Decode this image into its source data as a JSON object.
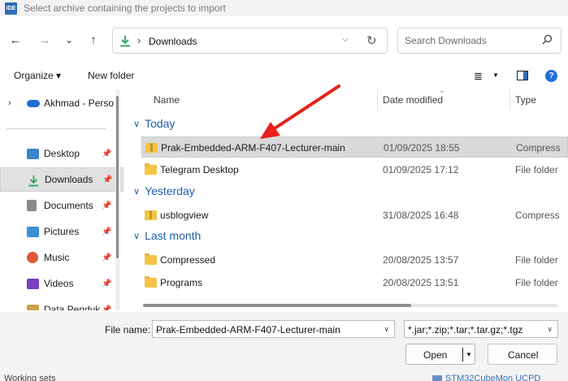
{
  "window": {
    "app_icon_text": "IDE",
    "title": "Select archive containing the projects to import"
  },
  "nav": {
    "back_icon": "←",
    "forward_icon": "→",
    "recent_icon": "⌄",
    "up_icon": "↑",
    "address_path": "Downloads",
    "search_placeholder": "Search Downloads"
  },
  "toolbar": {
    "organize_label": "Organize ▾",
    "new_folder_label": "New folder",
    "view_icon": "≣",
    "help_icon": "?"
  },
  "sidebar": {
    "onedrive_label": "Akhmad - Perso",
    "items": [
      {
        "label": "Desktop",
        "color": "#3a86c8"
      },
      {
        "label": "Downloads",
        "color": "#2aa35a"
      },
      {
        "label": "Documents",
        "color": "#8a8a8a"
      },
      {
        "label": "Pictures",
        "color": "#3a8fd6"
      },
      {
        "label": "Music",
        "color": "#e05a3c"
      },
      {
        "label": "Videos",
        "color": "#7a3fc0"
      },
      {
        "label": "Data Penduk",
        "color": "#c9a24a"
      }
    ]
  },
  "columns": {
    "name": "Name",
    "date_modified": "Date modified",
    "type": "Type"
  },
  "groups": [
    {
      "title": "Today",
      "rows": [
        {
          "name": "Prak-Embedded-ARM-F407-Lecturer-main",
          "date": "01/09/2025 18:55",
          "type": "Compress",
          "icon": "zip"
        },
        {
          "name": "Telegram Desktop",
          "date": "01/09/2025 17:12",
          "type": "File folder",
          "icon": "folder"
        }
      ]
    },
    {
      "title": "Yesterday",
      "rows": [
        {
          "name": "usblogview",
          "date": "31/08/2025 16:48",
          "type": "Compress",
          "icon": "zip"
        }
      ]
    },
    {
      "title": "Last month",
      "rows": [
        {
          "name": "Compressed",
          "date": "20/08/2025 13:57",
          "type": "File folder",
          "icon": "folder"
        },
        {
          "name": "Programs",
          "date": "20/08/2025 13:51",
          "type": "File folder",
          "icon": "folder"
        }
      ]
    }
  ],
  "footer": {
    "file_name_label": "File name:",
    "file_name_value": "Prak-Embedded-ARM-F407-Lecturer-main",
    "file_type_value": "*.jar;*.zip;*.tar;*.tar.gz;*.tgz",
    "open_label": "Open",
    "cancel_label": "Cancel"
  },
  "behind": {
    "left_text": "Working sets",
    "right_text": "STM32CubeMon UCPD"
  },
  "colors": {
    "accent": "#1f5fa8",
    "annotation_arrow": "#e8201b"
  }
}
